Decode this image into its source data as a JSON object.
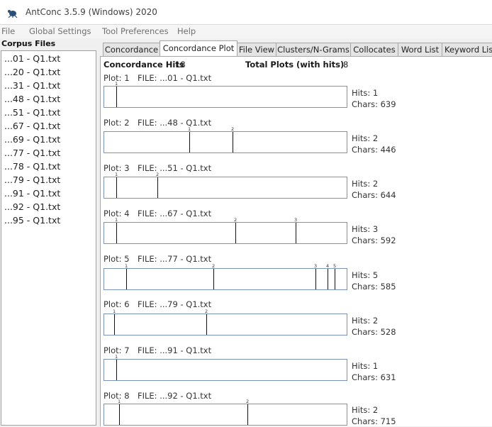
{
  "window": {
    "title": "AntConc 3.5.9 (Windows) 2020",
    "icon": "antconc-app-icon"
  },
  "menu": [
    "File",
    "Global Settings",
    "Tool Preferences",
    "Help"
  ],
  "sidebar": {
    "header": "Corpus Files",
    "files": [
      "...01 - Q1.txt",
      "...20 - Q1.txt",
      "...31 - Q1.txt",
      "...48 - Q1.txt",
      "...51 - Q1.txt",
      "...67 - Q1.txt",
      "...69 - Q1.txt",
      "...77 - Q1.txt",
      "...78 - Q1.txt",
      "...79 - Q1.txt",
      "...91 - Q1.txt",
      "...92 - Q1.txt",
      "...95 - Q1.txt"
    ]
  },
  "tabs": [
    "Concordance",
    "Concordance Plot",
    "File View",
    "Clusters/N-Grams",
    "Collocates",
    "Word List",
    "Keyword List"
  ],
  "active_tab": "Concordance Plot",
  "summary": {
    "hits_label": "Concordance Hits",
    "hits_value": "18",
    "plots_label": "Total Plots (with hits)",
    "plots_value": "8"
  },
  "plots": [
    {
      "plot": "Plot: 1",
      "file": "FILE: ...01 - Q1.txt",
      "hits": "Hits: 1",
      "chars": "Chars: 639",
      "hit_positions": [
        0.05
      ],
      "hit_numbers": [
        "1"
      ]
    },
    {
      "plot": "Plot: 2",
      "file": "FILE: ...48 - Q1.txt",
      "hits": "Hits: 2",
      "chars": "Chars: 446",
      "hit_positions": [
        0.35,
        0.53
      ],
      "hit_numbers": [
        "1",
        "2"
      ]
    },
    {
      "plot": "Plot: 3",
      "file": "FILE: ...51 - Q1.txt",
      "hits": "Hits: 2",
      "chars": "Chars: 644",
      "hit_positions": [
        0.05,
        0.22
      ],
      "hit_numbers": [
        "1",
        "2"
      ]
    },
    {
      "plot": "Plot: 4",
      "file": "FILE: ...67 - Q1.txt",
      "hits": "Hits: 3",
      "chars": "Chars: 592",
      "hit_positions": [
        0.05,
        0.54,
        0.79
      ],
      "hit_numbers": [
        "1",
        "2",
        "3"
      ]
    },
    {
      "plot": "Plot: 5",
      "file": "FILE: ...77 - Q1.txt",
      "hits": "Hits: 5",
      "chars": "Chars: 585",
      "hit_positions": [
        0.09,
        0.45,
        0.87,
        0.92,
        0.95
      ],
      "hit_numbers": [
        "1",
        "2",
        "3",
        "4",
        "5"
      ]
    },
    {
      "plot": "Plot: 6",
      "file": "FILE: ...79 - Q1.txt",
      "hits": "Hits: 2",
      "chars": "Chars: 528",
      "hit_positions": [
        0.04,
        0.42
      ],
      "hit_numbers": [
        "1",
        "2"
      ]
    },
    {
      "plot": "Plot: 7",
      "file": "FILE: ...91 - Q1.txt",
      "hits": "Hits: 1",
      "chars": "Chars: 631",
      "hit_positions": [
        0.05
      ],
      "hit_numbers": [
        "1"
      ]
    },
    {
      "plot": "Plot: 8",
      "file": "FILE: ...92 - Q1.txt",
      "hits": "Hits: 2",
      "chars": "Chars: 715",
      "hit_positions": [
        0.06,
        0.59
      ],
      "hit_numbers": [
        "1",
        "2"
      ]
    }
  ],
  "colors": {
    "plot_border": "#7a93b8",
    "hit_line": "#111111"
  }
}
